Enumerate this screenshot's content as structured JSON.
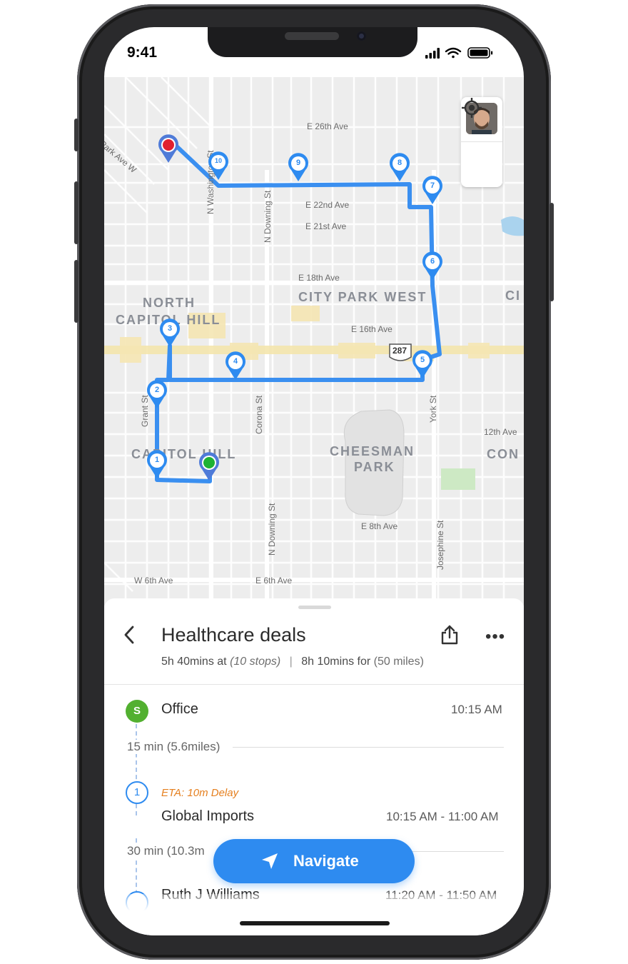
{
  "status": {
    "time": "9:41"
  },
  "map": {
    "streets": [
      "E 26th Ave",
      "E 22nd Ave",
      "E 21st Ave",
      "E 18th Ave",
      "E 16th Ave",
      "12th Ave",
      "E 8th Ave",
      "W 6th Ave",
      "E 6th Ave",
      "Park Ave W",
      "N Washington St",
      "N Downing St",
      "Grant St",
      "Corona St",
      "York St",
      "N Downing St",
      "Josephine St"
    ],
    "areas": [
      "NORTH",
      "CAPITOL HILL",
      "CITY PARK WEST",
      "CHEESMAN",
      "PARK",
      "CAPITOL HILL",
      "CON",
      "CI"
    ],
    "highway_shield": "287",
    "markers": [
      "1",
      "2",
      "3",
      "4",
      "5",
      "6",
      "7",
      "8",
      "9",
      "10"
    ],
    "route_color": "#3a8ff0",
    "start_color": "#1db233",
    "end_color": "#e0202e"
  },
  "controls": {
    "avatar_icon": "user-avatar",
    "locate_icon": "crosshair-icon"
  },
  "sheet": {
    "title": "Healthcare deals",
    "summary": {
      "duration_a": "5h 40mins at",
      "stops": "(10 stops)",
      "separator": "|",
      "duration_b": "8h 10mins for",
      "distance": "(50 miles)"
    },
    "start": {
      "badge": "S",
      "name": "Office",
      "time": "10:15 AM"
    },
    "legs": [
      "15 min (5.6miles)",
      "30 min (10.3m"
    ],
    "stop1": {
      "number": "1",
      "eta": "ETA: 10m Delay",
      "name": "Global Imports",
      "time": "10:15 AM - 11:00 AM"
    },
    "stop2": {
      "name": "Ruth J Williams",
      "time": "11:20 AM - 11:50 AM"
    },
    "navigate_label": "Navigate"
  }
}
